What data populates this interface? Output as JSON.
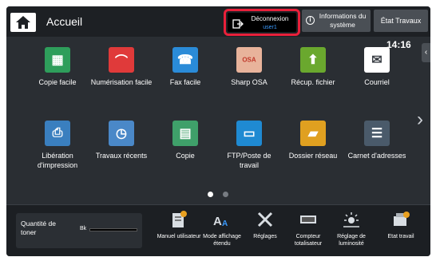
{
  "header": {
    "title": "Accueil",
    "logout": {
      "label": "Déconnexion",
      "user": "user1"
    },
    "system_info_label": "Informations du système",
    "job_status_label": "État Travaux",
    "clock": "14:16"
  },
  "apps": [
    {
      "label": "Copie facile",
      "icon": "copy-icon",
      "color": "#2e9e5b"
    },
    {
      "label": "Numérisation facile",
      "icon": "scan-icon",
      "color": "#e03a3a"
    },
    {
      "label": "Fax facile",
      "icon": "fax-icon",
      "color": "#2a8bd8"
    },
    {
      "label": "Sharp OSA",
      "icon": "osa-icon",
      "color": "#e8b39b"
    },
    {
      "label": "Récup. fichier",
      "icon": "file-retrieve-icon",
      "color": "#6aa82e"
    },
    {
      "label": "Courriel",
      "icon": "mail-icon",
      "color": "#ffffff"
    },
    {
      "label": "Libération d'impression",
      "icon": "print-release-icon",
      "color": "#3a7fbf"
    },
    {
      "label": "Travaux récents",
      "icon": "recent-jobs-icon",
      "color": "#4a88c8"
    },
    {
      "label": "Copie",
      "icon": "copy-icon",
      "color": "#3fa06a"
    },
    {
      "label": "FTP/Poste de travail",
      "icon": "ftp-desktop-icon",
      "color": "#1f8ad2"
    },
    {
      "label": "Dossier réseau",
      "icon": "network-folder-icon",
      "color": "#e0a020"
    },
    {
      "label": "Carnet d'adresses",
      "icon": "address-book-icon",
      "color": "#4a5a6a"
    }
  ],
  "toner": {
    "label": "Quantité de toner",
    "color_name": "Bk",
    "level": 1.0
  },
  "tools": [
    {
      "label": "Manuel utilisateur",
      "icon": "manual-icon"
    },
    {
      "label": "Mode affichage étendu",
      "icon": "display-mode-icon"
    },
    {
      "label": "Réglages",
      "icon": "settings-icon"
    },
    {
      "label": "Compteur totalisateur",
      "icon": "counter-icon"
    },
    {
      "label": "Réglage de luminosité",
      "icon": "brightness-icon"
    },
    {
      "label": "Etat travail",
      "icon": "job-status-icon"
    }
  ],
  "pager": {
    "current_page": 1,
    "total_pages": 2
  },
  "colors": {
    "accent_red": "#e8203a",
    "user_blue": "#3b9bff",
    "background": "#2a2e33"
  }
}
